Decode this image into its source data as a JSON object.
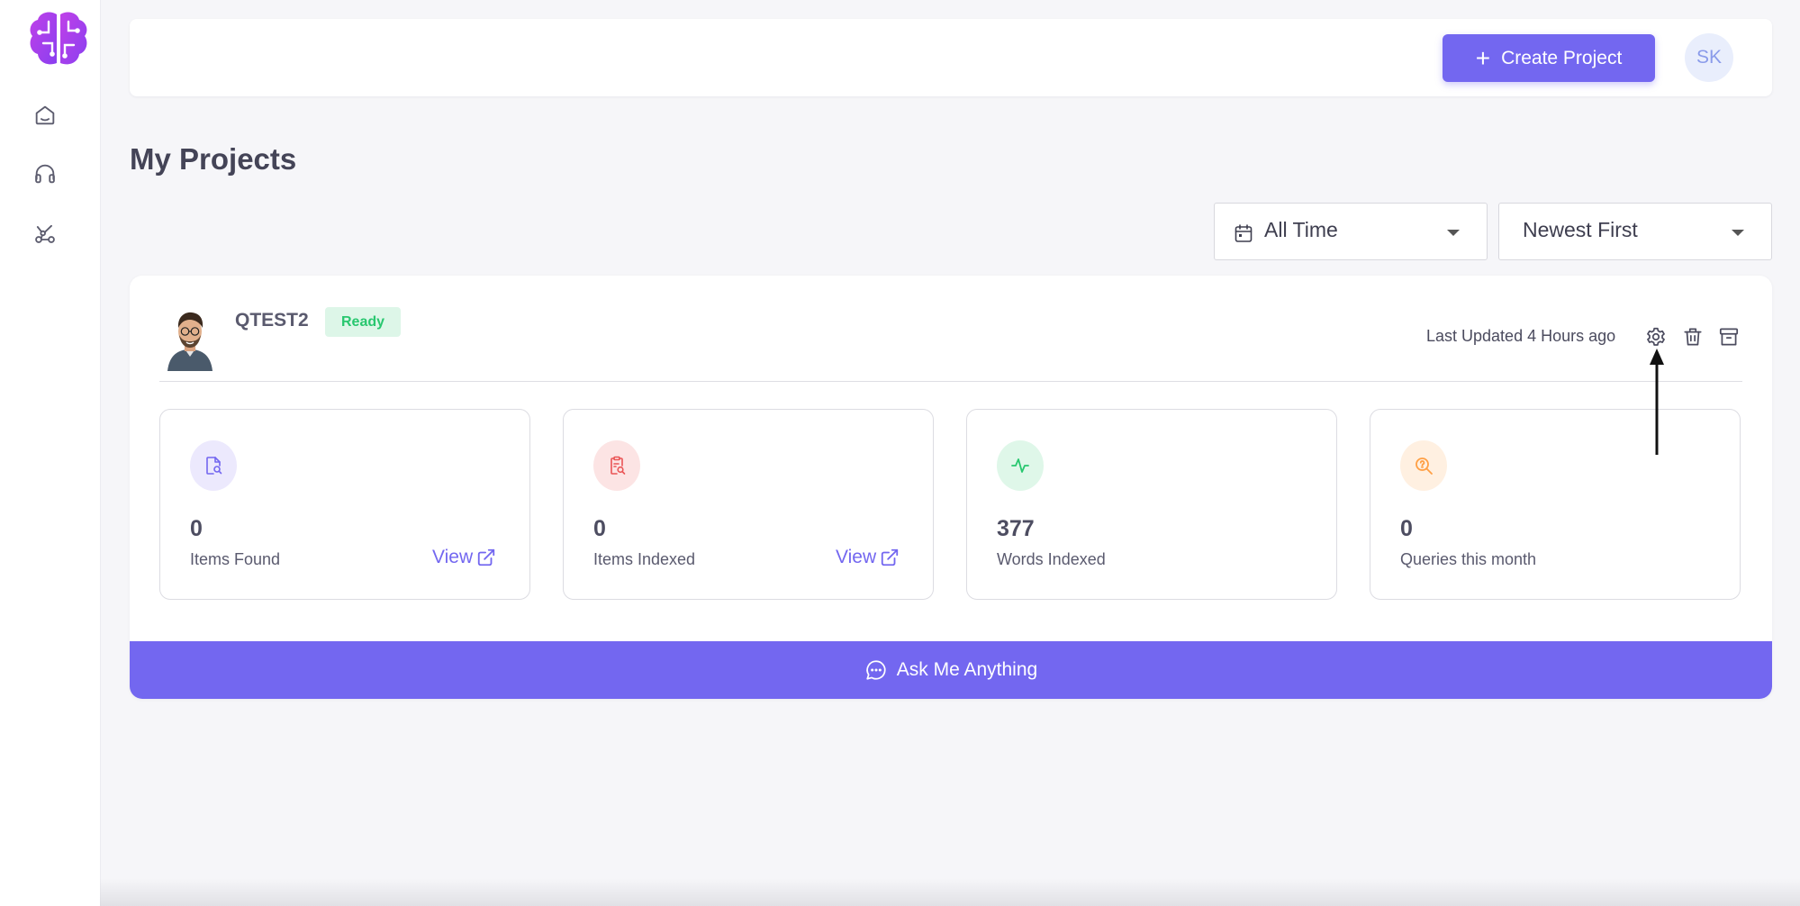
{
  "app": {
    "logo": "brain-circuit-logo"
  },
  "sidebar": {
    "items": [
      {
        "icon": "home-icon"
      },
      {
        "icon": "headphones-icon"
      },
      {
        "icon": "network-icon"
      }
    ]
  },
  "topbar": {
    "create_button": {
      "icon": "plus-icon",
      "label": "Create Project"
    },
    "user_initials": "SK"
  },
  "page": {
    "title": "My Projects"
  },
  "filters": {
    "time": {
      "icon": "calendar-icon",
      "value": "All Time"
    },
    "sort": {
      "value": "Newest First"
    }
  },
  "project": {
    "name": "QTEST2",
    "status": "Ready",
    "last_updated": "Last Updated 4 Hours ago",
    "actions": [
      "settings-icon",
      "trash-icon",
      "archive-icon"
    ],
    "stats": [
      {
        "value": "0",
        "label": "Items Found",
        "link": "View",
        "icon": "document-search-icon",
        "icon_color": "#7367f0",
        "icon_bg": "#ece9fd"
      },
      {
        "value": "0",
        "label": "Items Indexed",
        "link": "View",
        "icon": "clipboard-search-icon",
        "icon_color": "#ea5455",
        "icon_bg": "#fce4e4"
      },
      {
        "value": "377",
        "label": "Words Indexed",
        "icon": "activity-icon",
        "icon_color": "#28c76f",
        "icon_bg": "#dff7e9"
      },
      {
        "value": "0",
        "label": "Queries this month",
        "icon": "help-search-icon",
        "icon_color": "#ff9f43",
        "icon_bg": "#fff0e1"
      }
    ],
    "ask_button": {
      "icon": "chat-bubble-icon",
      "label": "Ask Me Anything"
    }
  },
  "colors": {
    "accent": "#7367f0",
    "success": "#28c76f",
    "background": "#f6f6f9"
  }
}
